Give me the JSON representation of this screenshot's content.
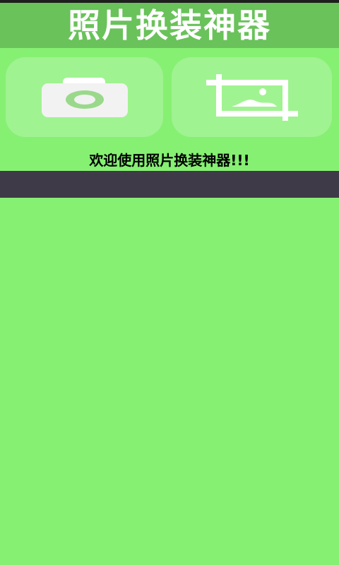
{
  "app": {
    "title": "照片换装神器"
  },
  "actions": [
    {
      "id": "camera",
      "icon": "camera-icon"
    },
    {
      "id": "crop",
      "icon": "crop-image-icon"
    }
  ],
  "welcome_text": "欢迎使用照片换装神器!!!",
  "colors": {
    "background": "#86f073",
    "title_bar": "#69c25a",
    "title_text": "#ffffff",
    "dark_band": "#3f3a48"
  }
}
